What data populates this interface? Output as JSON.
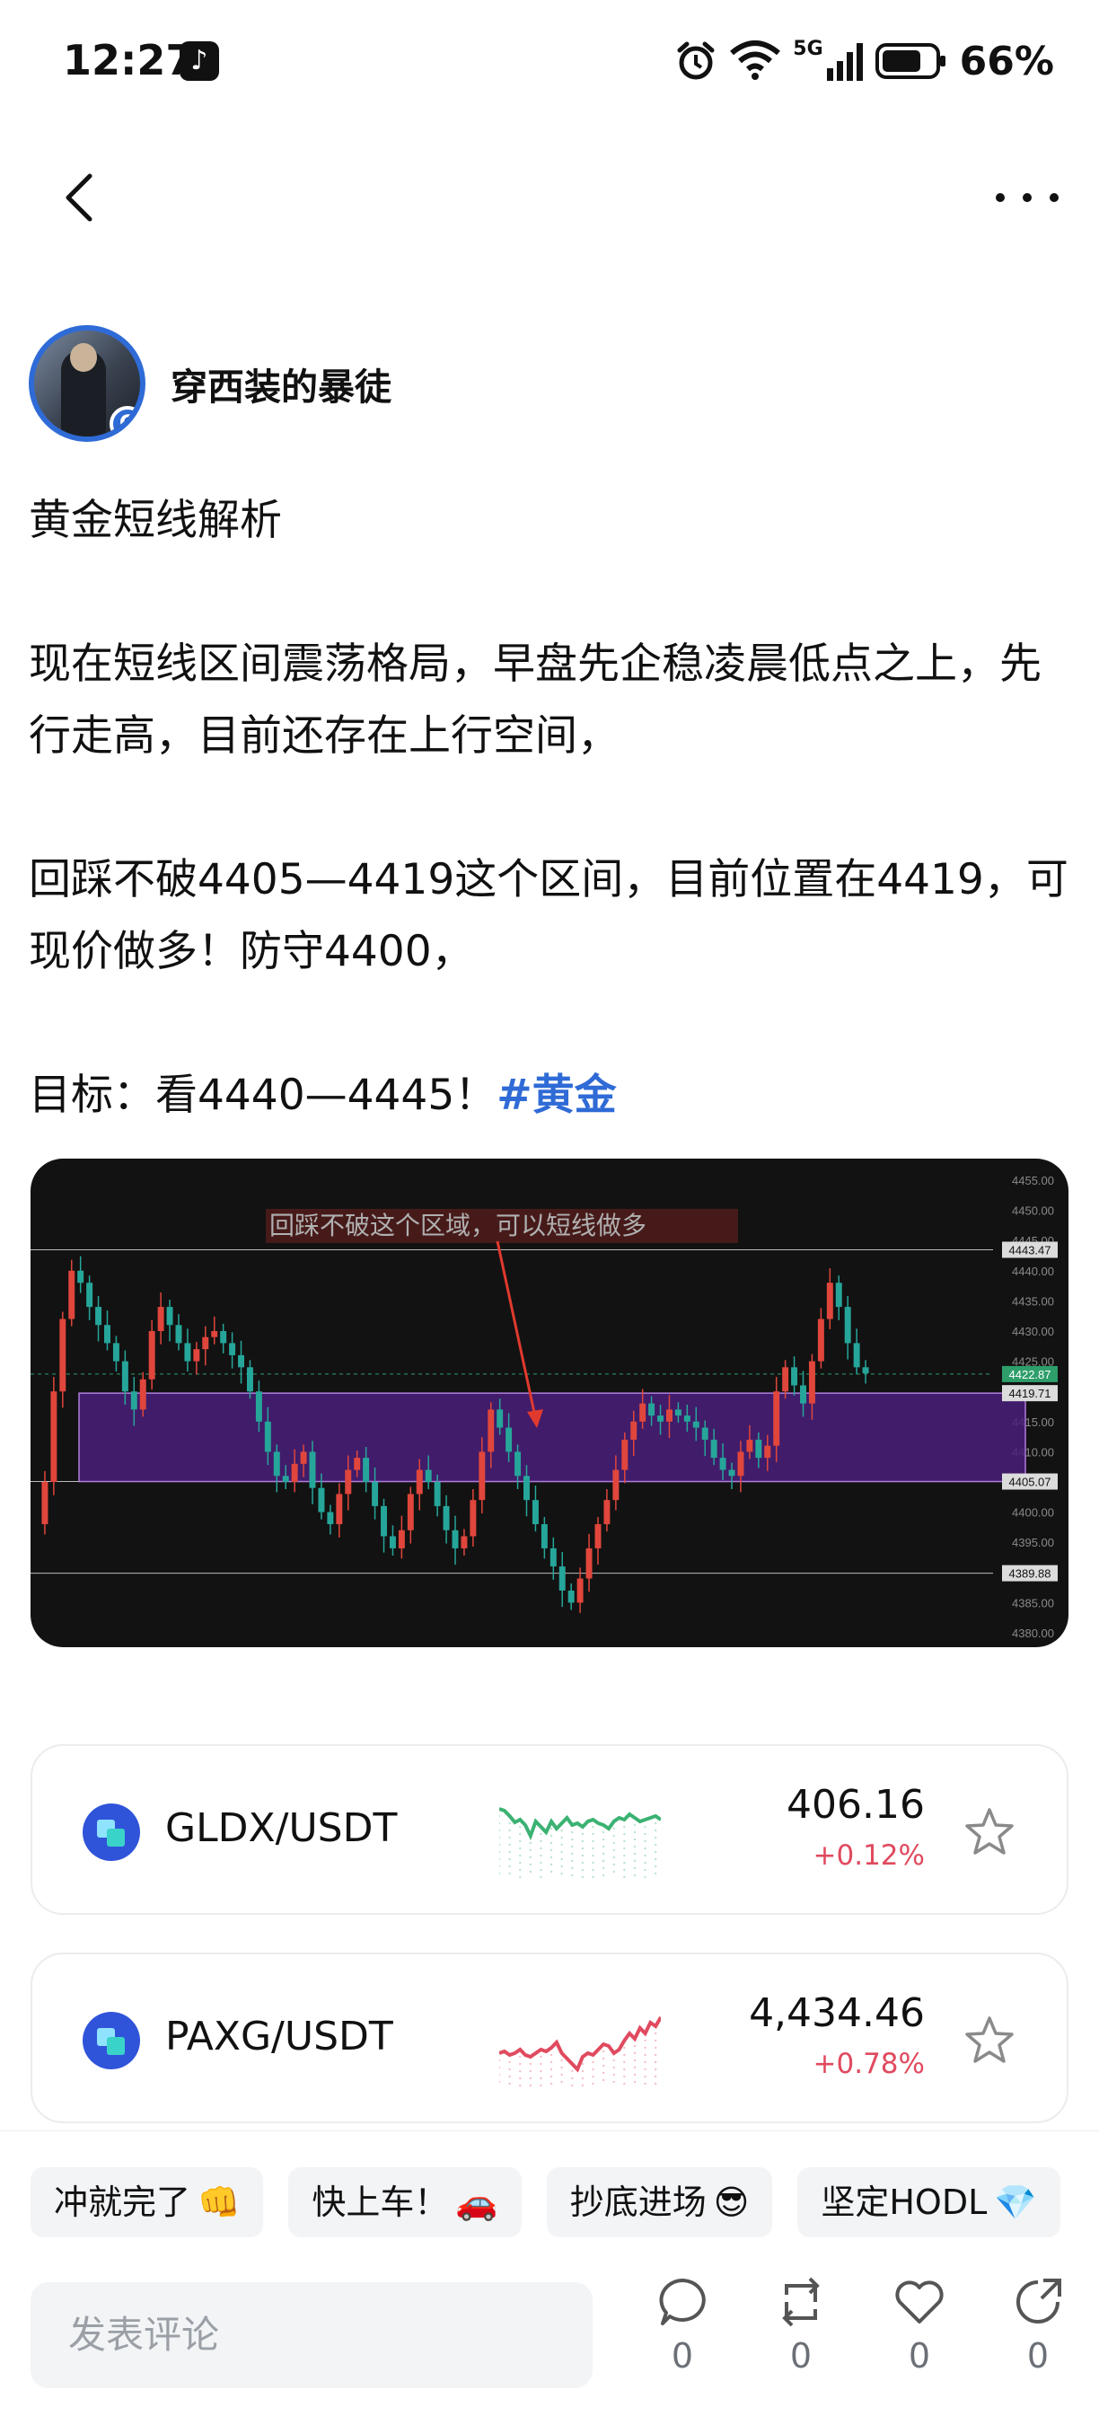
{
  "status_bar": {
    "time": "12:27",
    "network": "5G",
    "battery": "66%",
    "icons": [
      "tiktok-icon",
      "alarm-icon",
      "wifi-icon",
      "signal-icon",
      "battery-icon"
    ]
  },
  "nav": {
    "back_icon": "chevron-left-icon",
    "more_icon": "more-dots-icon"
  },
  "author": {
    "name": "穿西装的暴徒",
    "badge": "G"
  },
  "post": {
    "title": "黄金短线解析",
    "paragraph1": "现在短线区间震荡格局，早盘先企稳凌晨低点之上，先行走高，目前还存在上行空间，",
    "paragraph2": "回踩不破4405—4419这个区间，目前位置在4419，可现价做多！防守4400，",
    "paragraph3": "目标：看4440—4445！",
    "hashtag": "#黄金"
  },
  "chart_image": {
    "annotation": "回踩不破这个区域，可以短线做多",
    "axis_labels": [
      "4455.00",
      "4450.00",
      "4445.00",
      "4440.00",
      "4435.00",
      "4430.00",
      "4425.00",
      "4420.00",
      "4415.00",
      "4410.00",
      "4405.00",
      "4400.00",
      "4395.00",
      "4390.00",
      "4385.00",
      "4380.00"
    ],
    "price_tags": {
      "resistance": "4443.47",
      "current": "4422.87",
      "zone_top": "4419.71",
      "zone_bottom": "4405.07",
      "support": "4389.88"
    },
    "colors": {
      "up": "#e0463c",
      "down": "#26a69a",
      "zone": "#4a1e7a",
      "current_tag": "#2e9e6a"
    }
  },
  "markets": [
    {
      "pair": "GLDX/USDT",
      "price": "406.16",
      "change": "+0.12%",
      "trend_color": "#3bb272"
    },
    {
      "pair": "PAXG/USDT",
      "price": "4,434.46",
      "change": "+0.78%",
      "trend_color": "#e04a5f"
    }
  ],
  "quick_replies": [
    {
      "label": "冲就完了",
      "emoji": "👊"
    },
    {
      "label": "快上车！",
      "emoji": "🚗"
    },
    {
      "label": "抄底进场",
      "emoji": "😎"
    },
    {
      "label": "坚定HODL",
      "emoji": "💎"
    }
  ],
  "comment": {
    "placeholder": "发表评论"
  },
  "actions": [
    {
      "icon": "comment-icon",
      "count": "0"
    },
    {
      "icon": "repost-icon",
      "count": "0"
    },
    {
      "icon": "like-icon",
      "count": "0"
    },
    {
      "icon": "share-icon",
      "count": "0"
    }
  ]
}
